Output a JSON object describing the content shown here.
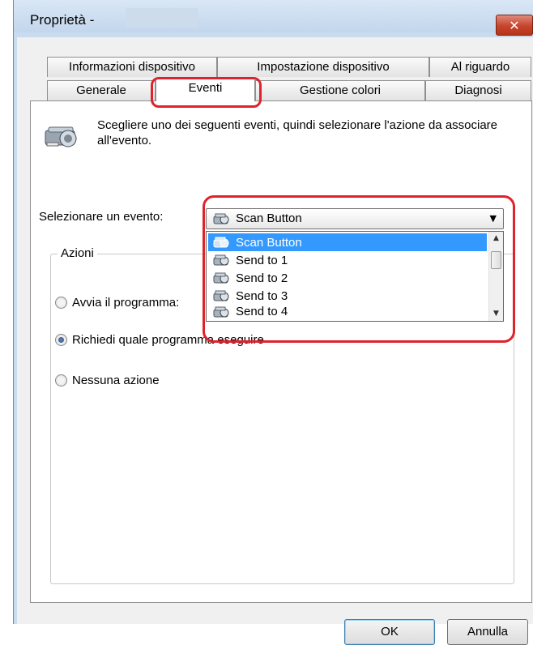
{
  "window": {
    "title": "Proprietà -",
    "close_label": "✕"
  },
  "tabs": {
    "row1": [
      "Informazioni dispositivo",
      "Impostazione dispositivo",
      "Al riguardo"
    ],
    "row2": [
      "Generale",
      "Eventi",
      "Gestione colori",
      "Diagnosi"
    ],
    "active": "Eventi"
  },
  "panel": {
    "description": "Scegliere uno dei seguenti eventi, quindi selezionare l'azione da associare all'evento.",
    "select_label": "Selezionare un evento:",
    "selected_event": "Scan Button",
    "event_options": [
      "Scan Button",
      "Send to 1",
      "Send to 2",
      "Send to 3",
      "Send to 4"
    ],
    "group_title": "Azioni",
    "actions": [
      {
        "label": "Avvia il programma:",
        "checked": false
      },
      {
        "label": "Richiedi quale programma eseguire",
        "checked": true
      },
      {
        "label": "Nessuna azione",
        "checked": false
      }
    ]
  },
  "buttons": {
    "ok": "OK",
    "cancel": "Annulla"
  },
  "colors": {
    "highlight": "#e0222c",
    "selection": "#3399ff"
  }
}
